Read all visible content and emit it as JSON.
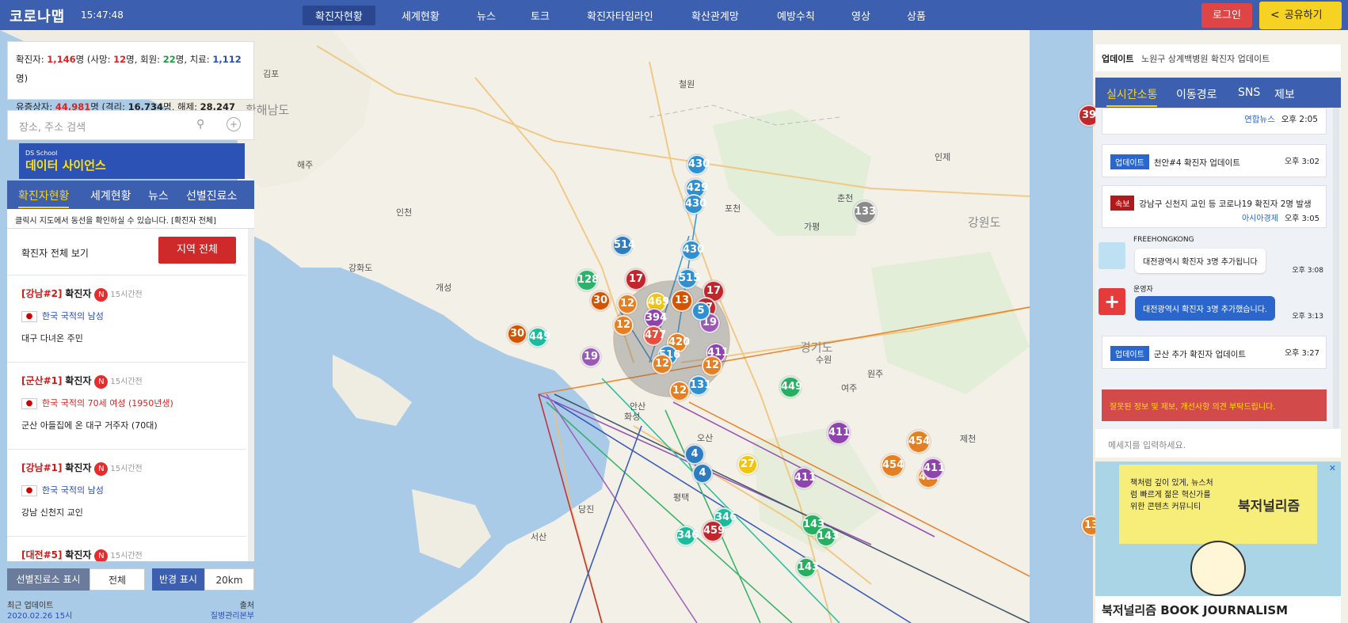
{
  "header": {
    "logo": "코로나맵",
    "clock": "15:47:48",
    "nav": [
      "확진자현황",
      "세계현황",
      "뉴스",
      "토크",
      "확진자타임라인",
      "확산관계망",
      "예방수칙",
      "영상",
      "상품"
    ],
    "login": "로그인",
    "share": "공유하기"
  },
  "stats": {
    "confirmed_label": "확진자: ",
    "confirmed": "1,146",
    "unit": "명",
    "death_label": " (사망: ",
    "death": "12",
    "recover_label": "명, 회원: ",
    "recover": "22",
    "treat_label": "명, 치료: ",
    "treat": "1,112",
    "close": "명)",
    "suspect_label": "유증상자: ",
    "suspect": "44,981",
    "isolate_label": "명 (격리: ",
    "isolate": "16,734",
    "release_label": "명, 해제: ",
    "release": "28,247",
    "close2": "명)"
  },
  "search": {
    "placeholder": "장소, 주소 검색"
  },
  "ad1": {
    "title": "데이터 사이언스",
    "brand": "DS School"
  },
  "left_tabs": [
    "확진자현황",
    "세계현황",
    "뉴스",
    "선별진료소"
  ],
  "hint": "클릭시 지도에서 동선을 확인하실 수 있습니다. [확진자 전체]",
  "cases_header": {
    "title": "확진자 전체 보기",
    "button": "지역 전체"
  },
  "cases": [
    {
      "title": "[강남#2]",
      "label": "확진자",
      "badge": "N",
      "ago": "15시간전",
      "nation": "한국 국적의 남성",
      "desc": "대구 다녀온 주민",
      "color": "#2a4cb8"
    },
    {
      "title": "[군산#1]",
      "label": "확진자",
      "badge": "N",
      "ago": "15시간전",
      "nation": "한국 국적의 70세 여성 (1950년생)",
      "desc": "군산 아들집에 온 대구 거주자 (70대)",
      "color": "#e02020"
    },
    {
      "title": "[강남#1]",
      "label": "확진자",
      "badge": "N",
      "ago": "15시간전",
      "nation": "한국 국적의 남성",
      "desc": "강남 신천지 교인",
      "color": "#2a4cb8"
    },
    {
      "title": "[대전#5]",
      "label": "확진자",
      "badge": "N",
      "ago": "15시간전",
      "nation": "",
      "desc": "",
      "color": "#2a4cb8"
    }
  ],
  "bottom": {
    "clinic_label": "선별진료소 표시",
    "clinic_value": "전체",
    "radius_label": "반경 표시",
    "radius_value": "20km"
  },
  "footer": {
    "updated_label": "최근 업데이트",
    "updated": "2020.02.26 15시",
    "source_label": "출처",
    "source": "질병관리본부"
  },
  "right": {
    "update_tag": "업데이트",
    "update_text": "노원구 상계백병원 확진자 업데이트",
    "tabs": [
      "실시간소통",
      "이동경로",
      "SNS",
      "제보"
    ],
    "feed": [
      {
        "source": "연합뉴스",
        "time": "오후 2:05"
      },
      {
        "tag": "업데이트",
        "tag_color": "#2a66cc",
        "text": "천안#4 확진자 업데이트",
        "time": "오후 3:02"
      },
      {
        "tag": "속보",
        "tag_color": "#b01a1a",
        "text": "강남구 신천지 교인 등 코로나19 확진자 2명 발생",
        "source": "아시아경제",
        "time": "오후 3:05"
      },
      {
        "user": "FREEHONGKONG",
        "text": "대전광역시 확진자 3명 추가됩니다",
        "time": "오후 3:08"
      },
      {
        "user": "운영자",
        "text": "대전광역시 확진자 3명 추가했습니다.",
        "time": "오후 3:13"
      },
      {
        "tag": "업데이트",
        "tag_color": "#2a66cc",
        "text": "군산 추가 확진자 업데이트",
        "time": "오후 3:27"
      }
    ],
    "report": "잘못된 정보 및 제보, 개선사항 의견 부탁드립니다.",
    "input_placeholder": "메세지를 입력하세요.",
    "ad_text": "북저널리즘 BOOK JOURNALISM",
    "ad_brand": "북저널리즘",
    "ad_copy": "책처럼 깊이 있게, 뉴스처럼 빠르게 젊은 혁신가를 위한 콘텐츠 커뮤니티"
  },
  "map": {
    "labels": [
      "황해남도",
      "경기도",
      "강원도",
      "춘천",
      "가평",
      "포천",
      "김포",
      "수원",
      "원주",
      "제천",
      "여주",
      "안산",
      "오산",
      "당진",
      "서산",
      "평택",
      "화성",
      "철원",
      "인제",
      "해주",
      "개성",
      "강화도",
      "인천"
    ],
    "markers": [
      {
        "n": "430",
        "c": "#2f8fd1"
      },
      {
        "n": "429",
        "c": "#2f8fd1"
      },
      {
        "n": "430",
        "c": "#2f8fd1"
      },
      {
        "n": "514",
        "c": "#2f7bbf"
      },
      {
        "n": "430",
        "c": "#2f8fd1"
      },
      {
        "n": "133",
        "c": "#8a8a8a"
      },
      {
        "n": "128",
        "c": "#2cb36a"
      },
      {
        "n": "17",
        "c": "#c0262c"
      },
      {
        "n": "515",
        "c": "#2f8fd1"
      },
      {
        "n": "17",
        "c": "#c0262c"
      },
      {
        "n": "30",
        "c": "#d35400"
      },
      {
        "n": "12",
        "c": "#e67e22"
      },
      {
        "n": "469",
        "c": "#f1c40f"
      },
      {
        "n": "13",
        "c": "#d35400"
      },
      {
        "n": "17",
        "c": "#c0262c"
      },
      {
        "n": "30",
        "c": "#d35400"
      },
      {
        "n": "449",
        "c": "#1abc9c"
      },
      {
        "n": "394",
        "c": "#8e44ad"
      },
      {
        "n": "19",
        "c": "#9b59b6"
      },
      {
        "n": "12",
        "c": "#e67e22"
      },
      {
        "n": "477",
        "c": "#e74c3c"
      },
      {
        "n": "420",
        "c": "#e67e22"
      },
      {
        "n": "19",
        "c": "#9b59b6"
      },
      {
        "n": "516",
        "c": "#2f8fd1"
      },
      {
        "n": "411",
        "c": "#8e44ad"
      },
      {
        "n": "12",
        "c": "#e67e22"
      },
      {
        "n": "12",
        "c": "#e67e22"
      },
      {
        "n": "131",
        "c": "#2f8fd1"
      },
      {
        "n": "12",
        "c": "#e67e22"
      },
      {
        "n": "449",
        "c": "#27ae60"
      },
      {
        "n": "411",
        "c": "#8e44ad"
      },
      {
        "n": "454",
        "c": "#e67e22"
      },
      {
        "n": "454",
        "c": "#e67e22"
      },
      {
        "n": "454",
        "c": "#e67e22"
      },
      {
        "n": "411",
        "c": "#8e44ad"
      },
      {
        "n": "4",
        "c": "#2f7bbf"
      },
      {
        "n": "4",
        "c": "#2f7bbf"
      },
      {
        "n": "27",
        "c": "#f1c40f"
      },
      {
        "n": "411",
        "c": "#8e44ad"
      },
      {
        "n": "346",
        "c": "#1abc9c"
      },
      {
        "n": "459",
        "c": "#c0262c"
      },
      {
        "n": "346",
        "c": "#1abc9c"
      },
      {
        "n": "143",
        "c": "#27ae60"
      },
      {
        "n": "143",
        "c": "#27ae60"
      },
      {
        "n": "143",
        "c": "#27ae60"
      },
      {
        "n": "39",
        "c": "#c0262c"
      },
      {
        "n": "13",
        "c": "#e67e22"
      },
      {
        "n": "5",
        "c": "#2f8fd1"
      }
    ]
  }
}
